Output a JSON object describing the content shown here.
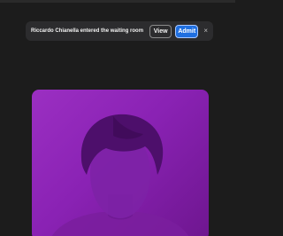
{
  "notification": {
    "message": "Riccardo Chianella entered the waiting room",
    "view_label": "View",
    "admit_label": "Admit",
    "close_glyph": "×"
  },
  "colors": {
    "background": "#1c1c1c",
    "notification_bg": "#2c2c2e",
    "admit_blue": "#1f6fe0",
    "tile_purple": "#8a22b4"
  },
  "video_tile": {
    "placeholder_icon": "person-silhouette-icon"
  }
}
